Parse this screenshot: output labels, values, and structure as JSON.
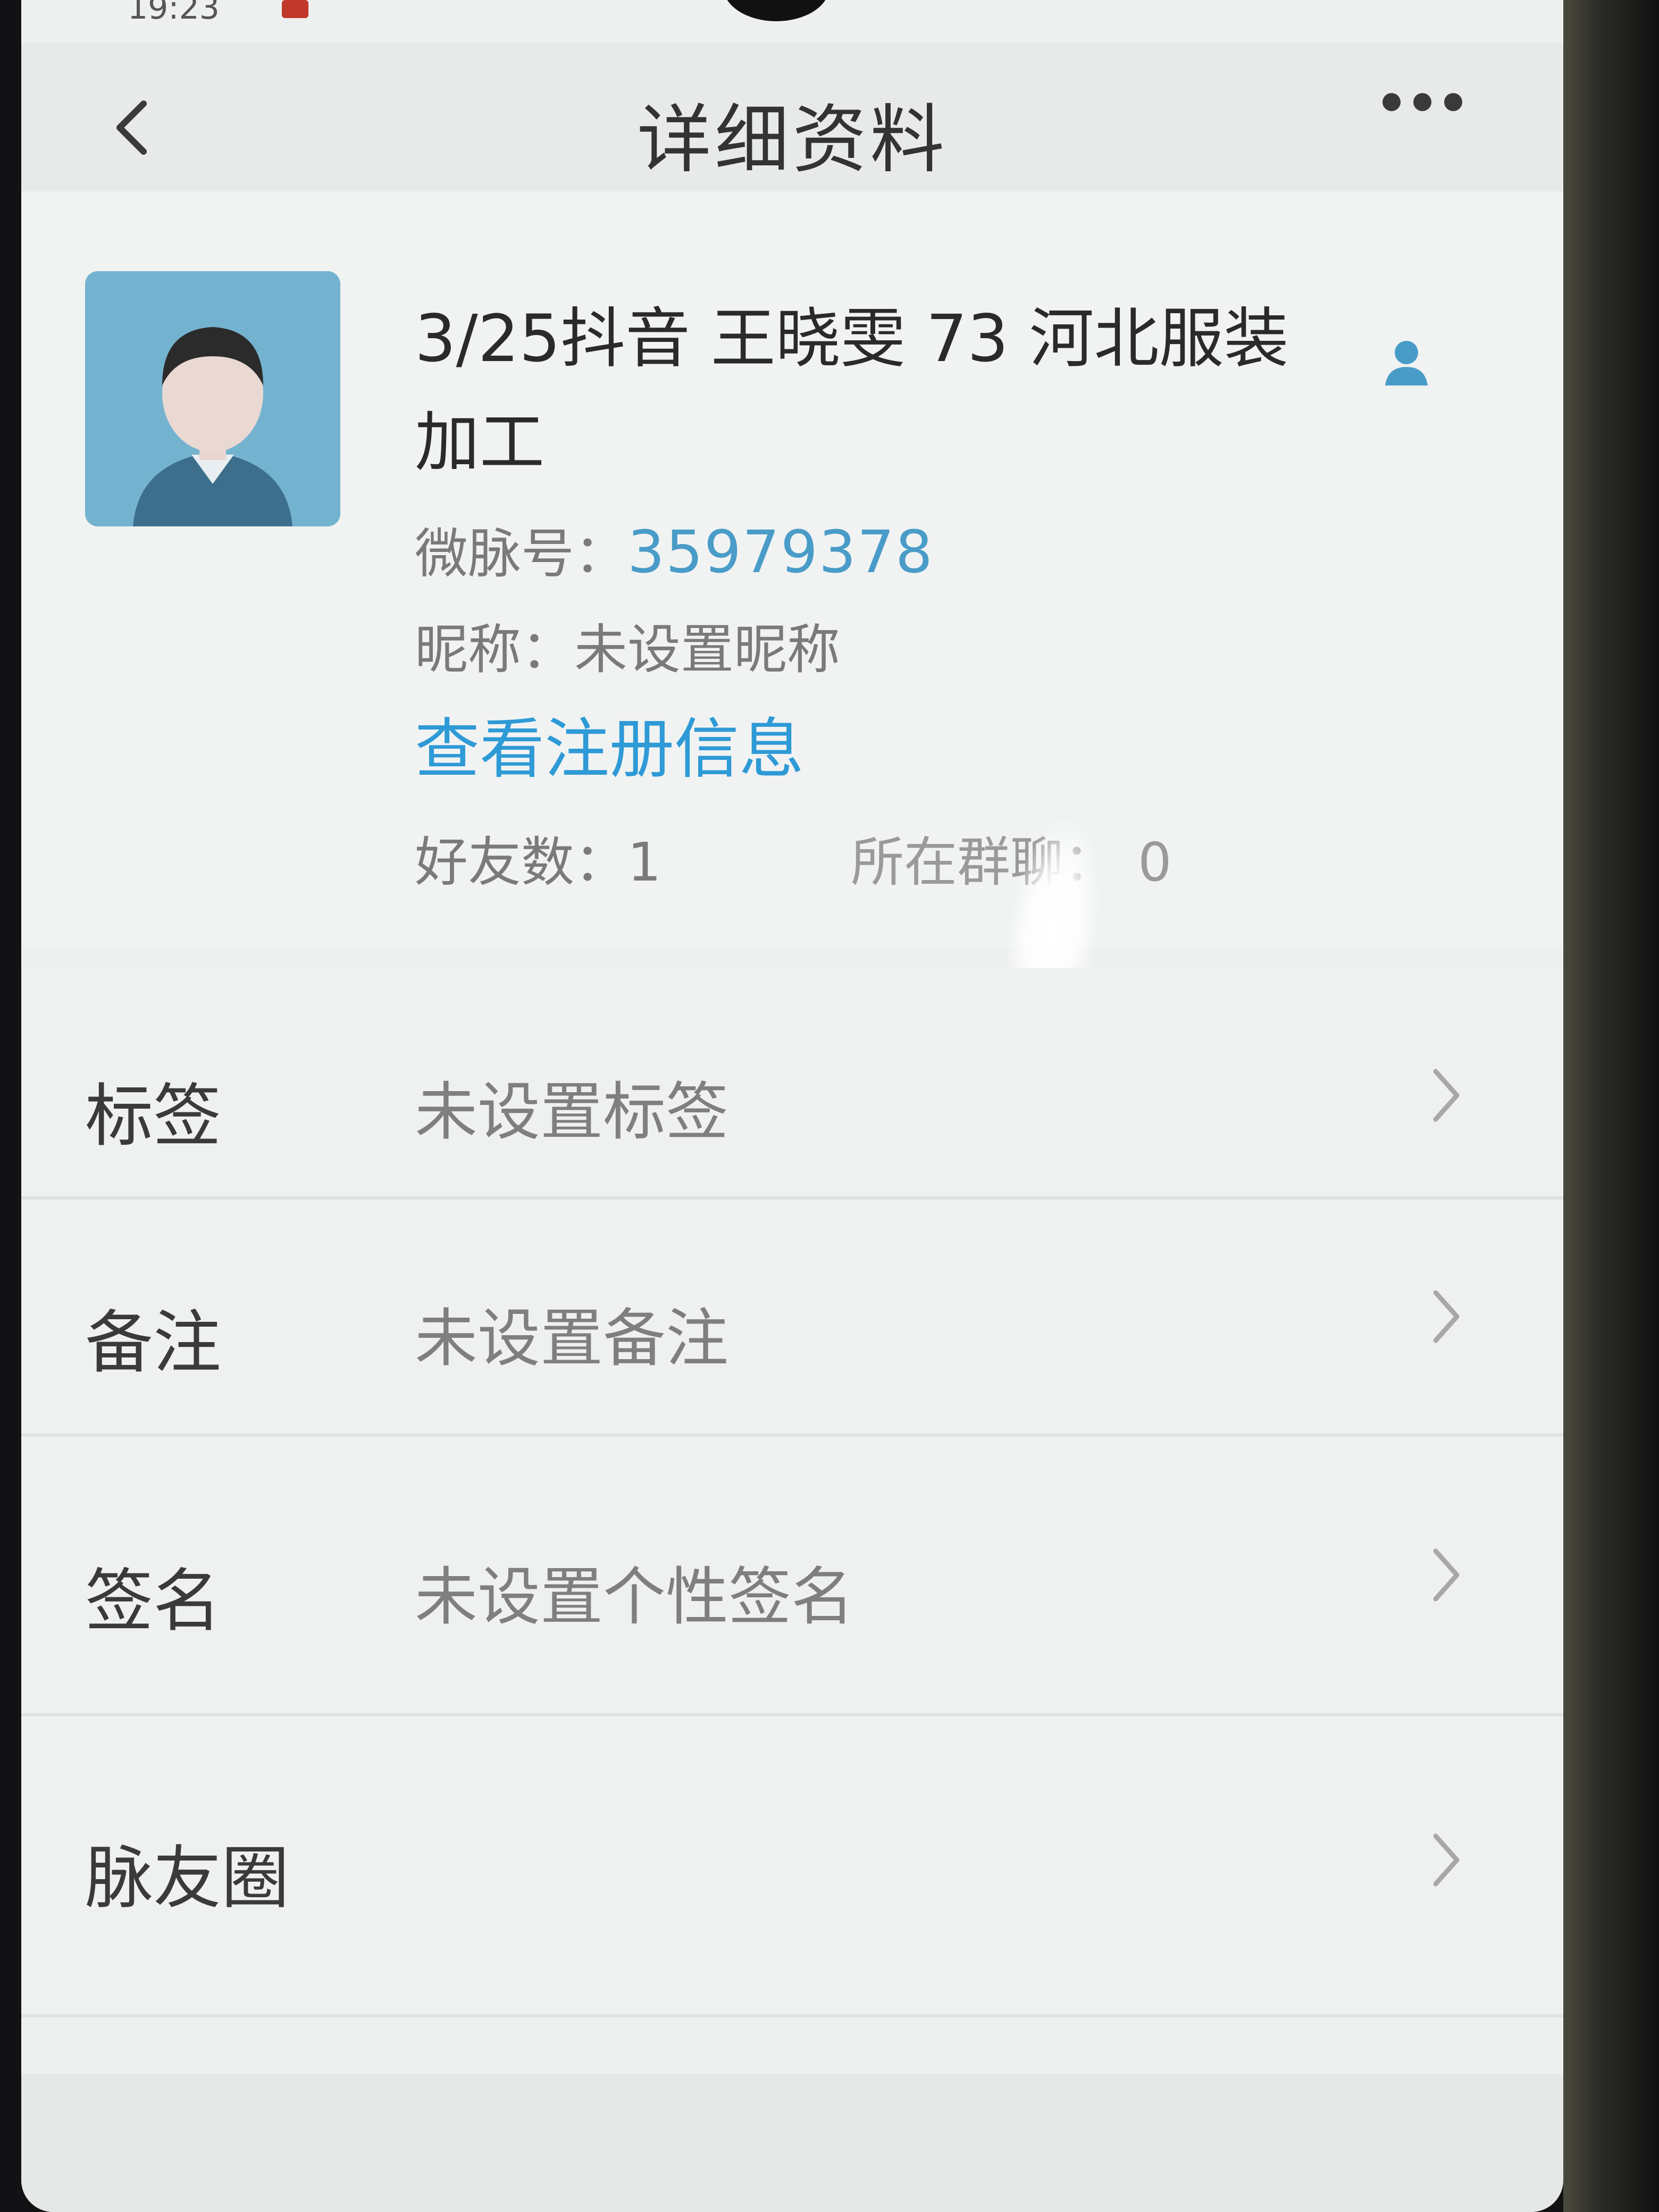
{
  "status_bar": {
    "time": "19:23"
  },
  "navbar": {
    "title": "详细资料",
    "back_icon": "chevron-left-icon",
    "more_icon": "more-dots-icon"
  },
  "profile": {
    "name": "3/25抖音 王晓雯 73 河北服装加工",
    "contact_icon": "person-icon",
    "id_label": "微脉号：",
    "id_value": "35979378",
    "nickname_label": "昵称：",
    "nickname_value": "未设置昵称",
    "view_registration_link": "查看注册信息",
    "friend_count_label": "好友数：",
    "friend_count_value": "1",
    "group_count_label": "所在群聊：",
    "group_count_value": "0"
  },
  "rows": [
    {
      "label": "标签",
      "value": "未设置标签"
    },
    {
      "label": "备注",
      "value": "未设置备注"
    },
    {
      "label": "签名",
      "value": "未设置个性签名"
    },
    {
      "label": "脉友圈",
      "value": ""
    }
  ],
  "colors": {
    "accent_link": "#2e9ad6",
    "id_value": "#4a9cc8",
    "avatar_bg": "#74b3cf",
    "screen_bg": "#eef0f0"
  }
}
